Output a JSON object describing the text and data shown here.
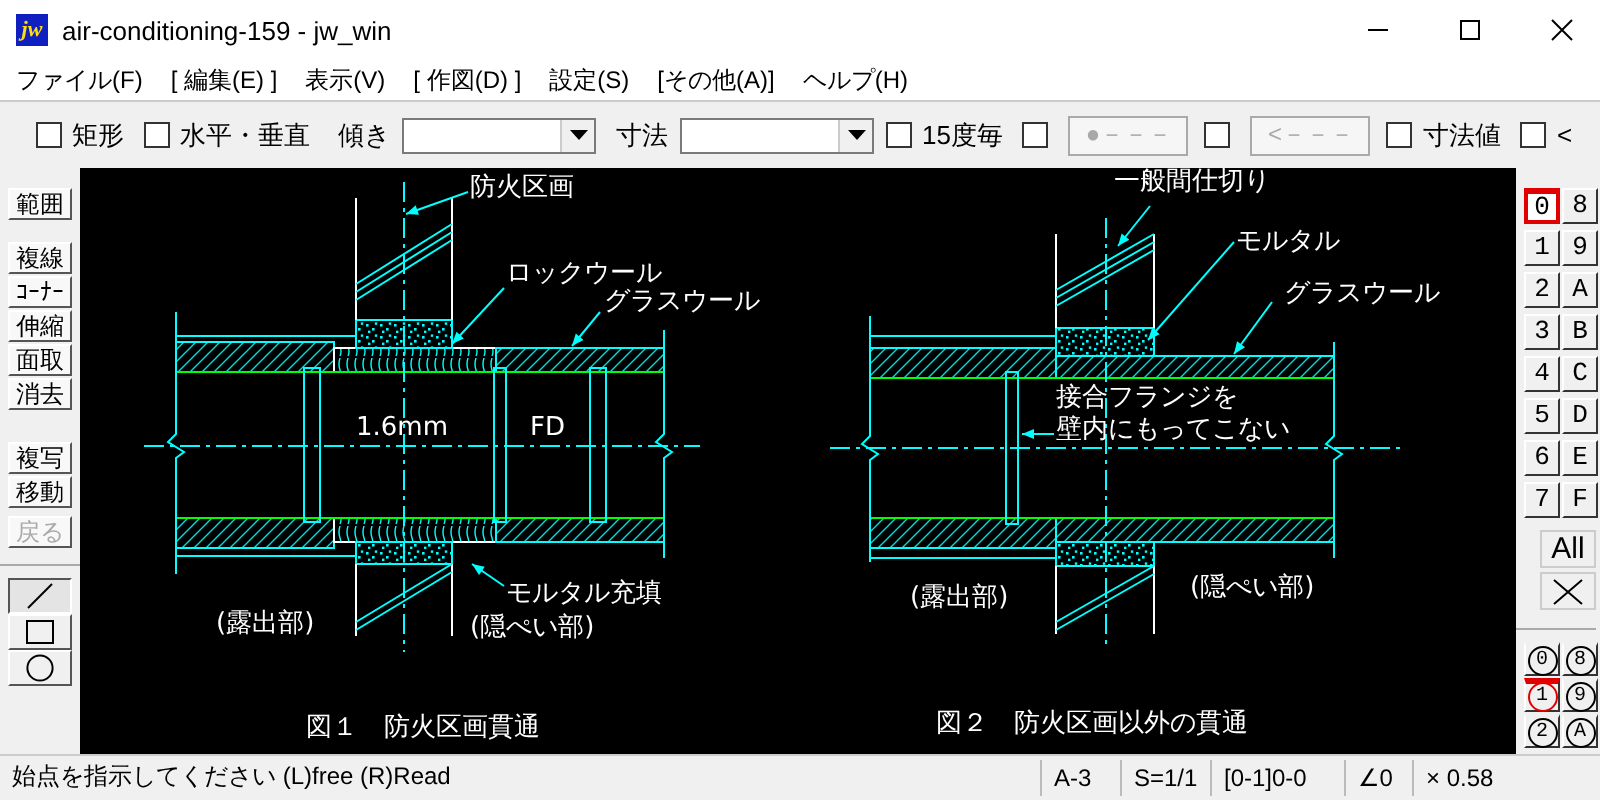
{
  "window": {
    "icon_text": "jw",
    "title": "air-conditioning-159 - jw_win"
  },
  "menu": [
    {
      "label": "ファイル(F)"
    },
    {
      "label": "[ 編集(E) ]"
    },
    {
      "label": "表示(V)"
    },
    {
      "label": "[ 作図(D) ]"
    },
    {
      "label": "設定(S)"
    },
    {
      "label": "[その他(A)]"
    },
    {
      "label": "ヘルプ(H)"
    }
  ],
  "toolbar": [
    {
      "kind": "checkbox",
      "label": "矩形",
      "checked": false
    },
    {
      "kind": "checkbox",
      "label": "水平・垂直",
      "checked": false
    },
    {
      "kind": "label",
      "label": "傾き"
    },
    {
      "kind": "dropdown"
    },
    {
      "kind": "label",
      "label": "寸法"
    },
    {
      "kind": "dropdown"
    },
    {
      "kind": "checkbox",
      "label": "15度毎",
      "checked": false
    },
    {
      "kind": "checkbox",
      "checked": false
    },
    {
      "kind": "button",
      "label": "●－－－",
      "disabled": true
    },
    {
      "kind": "checkbox",
      "checked": false
    },
    {
      "kind": "button",
      "label": "<－－－",
      "disabled": true
    },
    {
      "kind": "checkbox",
      "label": "寸法値",
      "checked": false
    },
    {
      "kind": "checkbox",
      "label": "<",
      "checked": false
    }
  ],
  "edit_tools": [
    [
      {
        "label": "範囲",
        "disabled": false
      }
    ],
    [
      {
        "label": "複線",
        "disabled": false
      },
      {
        "label": "ｺｰﾅｰ",
        "disabled": false
      },
      {
        "label": "伸縮",
        "disabled": false
      },
      {
        "label": "面取",
        "disabled": false
      },
      {
        "label": "消去",
        "disabled": false
      }
    ],
    [
      {
        "label": "複写",
        "disabled": false
      },
      {
        "label": "移動",
        "disabled": false
      }
    ],
    [
      {
        "label": "戻る",
        "disabled": true
      }
    ]
  ],
  "draw_tools": [
    {
      "kind": "line",
      "selected": true
    },
    {
      "kind": "rectangle",
      "selected": false
    },
    {
      "kind": "circle",
      "selected": false
    }
  ],
  "layers": [
    {
      "label": "0",
      "selected": true
    },
    {
      "label": "8",
      "selected": false
    },
    {
      "label": "1",
      "selected": false
    },
    {
      "label": "9",
      "selected": false
    },
    {
      "label": "2",
      "selected": false
    },
    {
      "label": "A",
      "selected": false
    },
    {
      "label": "3",
      "selected": false
    },
    {
      "label": "B",
      "selected": false
    },
    {
      "label": "4",
      "selected": false
    },
    {
      "label": "C",
      "selected": false
    },
    {
      "label": "5",
      "selected": false
    },
    {
      "label": "D",
      "selected": false
    },
    {
      "label": "6",
      "selected": false
    },
    {
      "label": "E",
      "selected": false
    },
    {
      "label": "7",
      "selected": false
    },
    {
      "label": "F",
      "selected": false
    }
  ],
  "layer_actions": [
    {
      "kind": "text",
      "label": "All"
    },
    {
      "kind": "clear"
    }
  ],
  "layer_groups": [
    {
      "label": "0",
      "selected": false
    },
    {
      "label": "8",
      "selected": false
    },
    {
      "label": "1",
      "selected": true
    },
    {
      "label": "9",
      "selected": false
    },
    {
      "label": "2",
      "selected": false
    },
    {
      "label": "A",
      "selected": false
    }
  ],
  "drawing": {
    "figures": [
      {
        "labels": [
          "防火区画",
          "ロックウール",
          "グラスウール",
          "1.6mm",
          "FD",
          "モルタル充填",
          "(露出部)",
          "(隠ぺい部)"
        ],
        "caption": "図１　防火区画貫通"
      },
      {
        "labels": [
          "一般間仕切り",
          "モルタル",
          "グラスウール",
          "接合フランジを",
          "壁内にもってこない",
          "(露出部)",
          "(隠ぺい部)"
        ],
        "caption": "図２　防火区画以外の貫通"
      }
    ]
  },
  "status_bar": {
    "message": "始点を指示してください (L)free (R)Read",
    "fields": [
      "A-3",
      "S=1/1",
      "[0-1]0-0",
      "∠0",
      "× 0.58"
    ]
  }
}
